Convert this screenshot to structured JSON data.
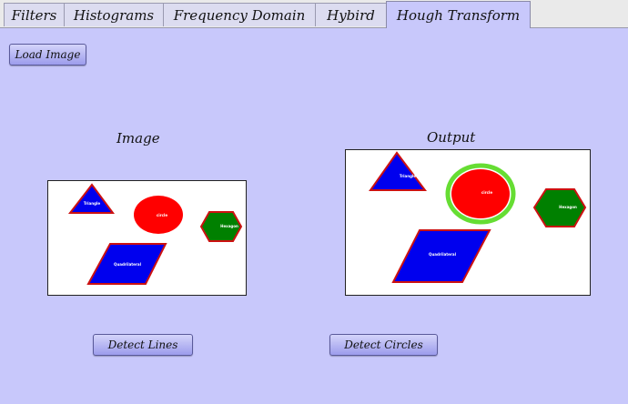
{
  "tabs": [
    {
      "label": "Filters"
    },
    {
      "label": "Histograms"
    },
    {
      "label": "Frequency Domain"
    },
    {
      "label": "Hybird"
    },
    {
      "label": "Hough Transform"
    }
  ],
  "active_tab": "Hough Transform",
  "buttons": {
    "load_image": "Load Image",
    "detect_lines": "Detect Lines",
    "detect_circles": "Detect Circles"
  },
  "panels": {
    "image_title": "Image",
    "output_title": "Output"
  },
  "shapes": {
    "triangle": "Triangle",
    "circle": "circle",
    "hexagon": "Hexagon",
    "quadrilateral": "Quadrilateral"
  },
  "colors": {
    "background": "#c8c8fb",
    "triangle_fill": "#0000ee",
    "circle_fill": "#ff0000",
    "hexagon_fill": "#008000",
    "quad_fill": "#0000ee",
    "shape_outline": "#cc1111",
    "detected_circle": "#66dd33"
  }
}
